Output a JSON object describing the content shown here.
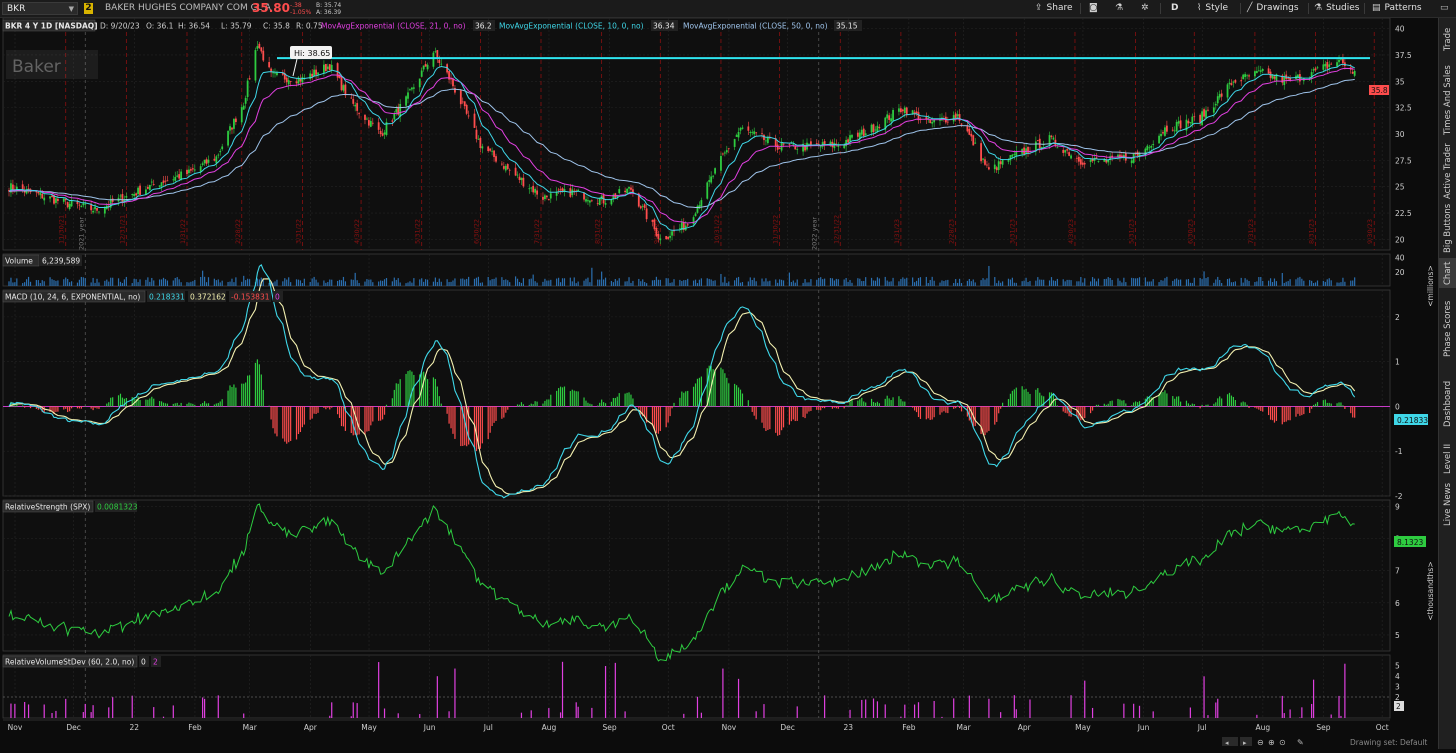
{
  "topbar": {
    "symbol": "BKR",
    "link_badge": "2",
    "company": "BAKER HUGHES COMPANY COM CL A",
    "last_price": "35.80",
    "change": "-.38",
    "change_pct": "-1.05%",
    "bid": "B: 35.74",
    "ask": "A: 36.39",
    "buttons": {
      "share": "Share",
      "interval": "D",
      "style": "Style",
      "drawings": "Drawings",
      "studies": "Studies",
      "patterns": "Patterns"
    }
  },
  "sidebar": {
    "items": [
      "Trade",
      "Times And Sales",
      "Active Trader",
      "Big Buttons",
      "Chart",
      "Phase Scores",
      "Dashboard",
      "Level II",
      "Live News"
    ],
    "active_index": 4
  },
  "price_panel": {
    "header": {
      "title": "BKR 4 Y 1D [NASDAQ]",
      "date": "D: 9/20/23",
      "open": "O: 36.1",
      "high": "H: 36.54",
      "low": "L: 35.79",
      "close": "C: 35.8",
      "range": "R: 0.75",
      "ema21_label": "MovAvgExponential (CLOSE, 21, 0, no)",
      "ema21_value": "36.2",
      "ema10_label": "MovAvgExponential (CLOSE, 10, 0, no)",
      "ema10_value": "36.34",
      "ema50_label": "MovAvgExponential (CLOSE, 50, 0, no)",
      "ema50_value": "35.15"
    },
    "watermark": "Baker",
    "hi_callout": "Hi: 38.65",
    "last_label": "35.8",
    "yaxis": [
      "40",
      "37.5",
      "35",
      "32.5",
      "30",
      "27.5",
      "25",
      "22.5",
      "20"
    ],
    "date_markers": [
      "11/30/21",
      "12/31/21",
      "1/31/22",
      "2/28/22",
      "3/31/22",
      "4/30/22",
      "5/31/22",
      "6/30/22",
      "7/31/22",
      "8/31/22",
      "9/30/22",
      "10/31/22",
      "11/30/22",
      "12/31/22",
      "1/31/23",
      "2/28/23",
      "3/31/23",
      "4/30/23",
      "5/31/23",
      "6/30/23",
      "7/31/23",
      "8/31/23",
      "9/30/23"
    ],
    "year_markers": [
      "2021 year",
      "2022 year"
    ],
    "resistance_level": 37.2
  },
  "volume_panel": {
    "title": "Volume",
    "value": "6,239,589",
    "yaxis": [
      "40",
      "20"
    ],
    "unit": "<millions>"
  },
  "macd_panel": {
    "title": "MACD (10, 24, 6, EXPONENTIAL, no)",
    "value1": "0.218331",
    "value2": "0.372162",
    "value3": "-0.153831",
    "value4": "0",
    "last_label": "0.21833",
    "yaxis": [
      "2",
      "1",
      "0",
      "-1",
      "-2"
    ]
  },
  "rs_panel": {
    "title": "RelativeStrength (SPX)",
    "value": "0.0081323",
    "last_label": "8.1323",
    "yaxis": [
      "9",
      "8",
      "7",
      "6",
      "5"
    ],
    "unit": "<thousandths>"
  },
  "rvsd_panel": {
    "title": "RelativeVolumeStDev (60, 2.0, no)",
    "value1": "0",
    "value2": "2",
    "last_label": "2",
    "yaxis": [
      "5",
      "4",
      "3",
      "2"
    ]
  },
  "xaxis": [
    "Nov",
    "Dec",
    "22",
    "Feb",
    "Mar",
    "Apr",
    "May",
    "Jun",
    "Jul",
    "Aug",
    "Sep",
    "Oct",
    "Nov",
    "Dec",
    "23",
    "Feb",
    "Mar",
    "Apr",
    "May",
    "Jun",
    "Jul",
    "Aug",
    "Sep",
    "Oct"
  ],
  "footer": {
    "drawing_set": "Drawing set: Default"
  },
  "colors": {
    "background": "#0c0c0c",
    "up_candle": "#2ecc40",
    "down_candle": "#ff4d4d",
    "ema10": "#3fd7e8",
    "ema21": "#e040e0",
    "ema50": "#9ec3ea",
    "resistance": "#2ee6f0",
    "volume": "#2b6fb0",
    "macd_line": "#f3f0b0",
    "macd_signal": "#3fd7e8",
    "rs_line": "#2ecc40",
    "rvsd_bar": "#e040e0"
  },
  "chart_data": [
    {
      "type": "candlestick",
      "title": "BKR 4 Y 1D [NASDAQ]",
      "series_points": [
        [
          "11/01/21",
          25.0
        ],
        [
          "11/15/21",
          24.3
        ],
        [
          "12/01/21",
          23.4
        ],
        [
          "12/15/21",
          22.8
        ],
        [
          "01/03/22",
          24.3
        ],
        [
          "01/18/22",
          25.5
        ],
        [
          "02/01/22",
          26.3
        ],
        [
          "02/15/22",
          27.8
        ],
        [
          "03/01/22",
          33.0
        ],
        [
          "03/08/22",
          38.65
        ],
        [
          "03/15/22",
          35.5
        ],
        [
          "03/31/22",
          35.2
        ],
        [
          "04/14/22",
          36.5
        ],
        [
          "04/25/22",
          33.0
        ],
        [
          "05/10/22",
          30.0
        ],
        [
          "05/24/22",
          33.5
        ],
        [
          "06/06/22",
          37.8
        ],
        [
          "06/15/22",
          35.0
        ],
        [
          "06/30/22",
          29.0
        ],
        [
          "07/15/22",
          26.5
        ],
        [
          "08/01/22",
          24.0
        ],
        [
          "08/16/22",
          24.5
        ],
        [
          "09/01/22",
          23.7
        ],
        [
          "09/15/22",
          24.8
        ],
        [
          "09/30/22",
          20.0
        ],
        [
          "10/14/22",
          21.5
        ],
        [
          "10/31/22",
          27.5
        ],
        [
          "11/10/22",
          30.5
        ],
        [
          "11/30/22",
          28.8
        ],
        [
          "12/15/22",
          28.8
        ],
        [
          "12/30/22",
          29.0
        ],
        [
          "01/16/23",
          30.5
        ],
        [
          "02/01/23",
          32.5
        ],
        [
          "02/15/23",
          31.0
        ],
        [
          "03/01/23",
          31.8
        ],
        [
          "03/17/23",
          26.5
        ],
        [
          "03/31/23",
          28.0
        ],
        [
          "04/17/23",
          29.5
        ],
        [
          "05/03/23",
          27.5
        ],
        [
          "05/16/23",
          27.4
        ],
        [
          "06/01/23",
          28.0
        ],
        [
          "06/15/23",
          30.5
        ],
        [
          "07/03/23",
          31.5
        ],
        [
          "07/20/23",
          35.0
        ],
        [
          "08/03/23",
          35.8
        ],
        [
          "08/17/23",
          35.0
        ],
        [
          "09/01/23",
          36.0
        ],
        [
          "09/12/23",
          37.0
        ],
        [
          "09/20/23",
          35.8
        ]
      ],
      "ema10_last": 36.34,
      "ema21_last": 36.2,
      "ema50_last": 35.15,
      "ylim": [
        19,
        41
      ]
    },
    {
      "type": "bar",
      "title": "Volume",
      "last": 6239589,
      "ylim": [
        0,
        45
      ],
      "unit": "millions"
    },
    {
      "type": "line",
      "title": "MACD (10, 24, 6, EXPONENTIAL, no)",
      "last_macd": 0.218331,
      "last_signal": 0.372162,
      "last_diff": -0.153831,
      "ylim": [
        -2,
        2.6
      ]
    },
    {
      "type": "line",
      "title": "RelativeStrength (SPX)",
      "last": 8.1323,
      "ylim": [
        4.5,
        9.2
      ],
      "unit": "thousandths"
    },
    {
      "type": "bar",
      "title": "RelativeVolumeStDev (60, 2.0, no)",
      "last": 2,
      "ylim": [
        0,
        6
      ]
    }
  ]
}
